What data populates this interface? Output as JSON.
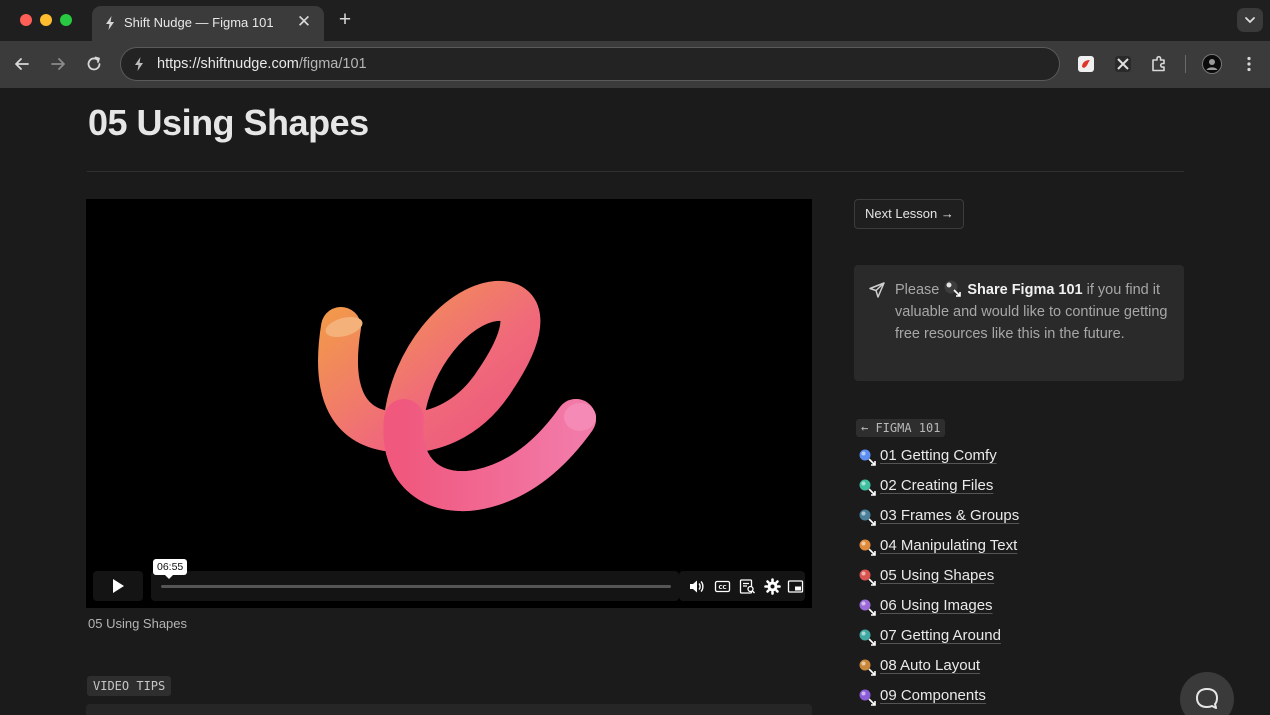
{
  "browser": {
    "tab_title": "Shift Nudge — Figma 101",
    "url_host": "https://shiftnudge.com",
    "url_path": "/figma/101",
    "close_glyph": "✕",
    "newtab_glyph": "+"
  },
  "page": {
    "title": "05 Using Shapes",
    "video_caption": "05 Using Shapes",
    "video_time_tooltip": "06:55",
    "video_tips_label": "VIDEO TIPS"
  },
  "sidebar": {
    "next_lesson": "Next Lesson →",
    "share": {
      "prefix": "Please",
      "link": "Share Figma 101",
      "suffix": " if you find it valuable and would like to continue getting free resources like this in the future."
    },
    "course_label": "← FIGMA 101",
    "lessons": [
      {
        "label": "01 Getting Comfy",
        "color": "#5b8ef0"
      },
      {
        "label": "02 Creating Files",
        "color": "#3fbf9f"
      },
      {
        "label": "03 Frames & Groups",
        "color": "#4a7f9a"
      },
      {
        "label": "04 Manipulating Text",
        "color": "#e08a3c"
      },
      {
        "label": "05 Using Shapes",
        "color": "#d9534f"
      },
      {
        "label": "06 Using Images",
        "color": "#9b6ad8"
      },
      {
        "label": "07 Getting Around",
        "color": "#3fa8a0"
      },
      {
        "label": "08 Auto Layout",
        "color": "#c9873a"
      },
      {
        "label": "09 Components",
        "color": "#8a5cd8"
      }
    ]
  }
}
